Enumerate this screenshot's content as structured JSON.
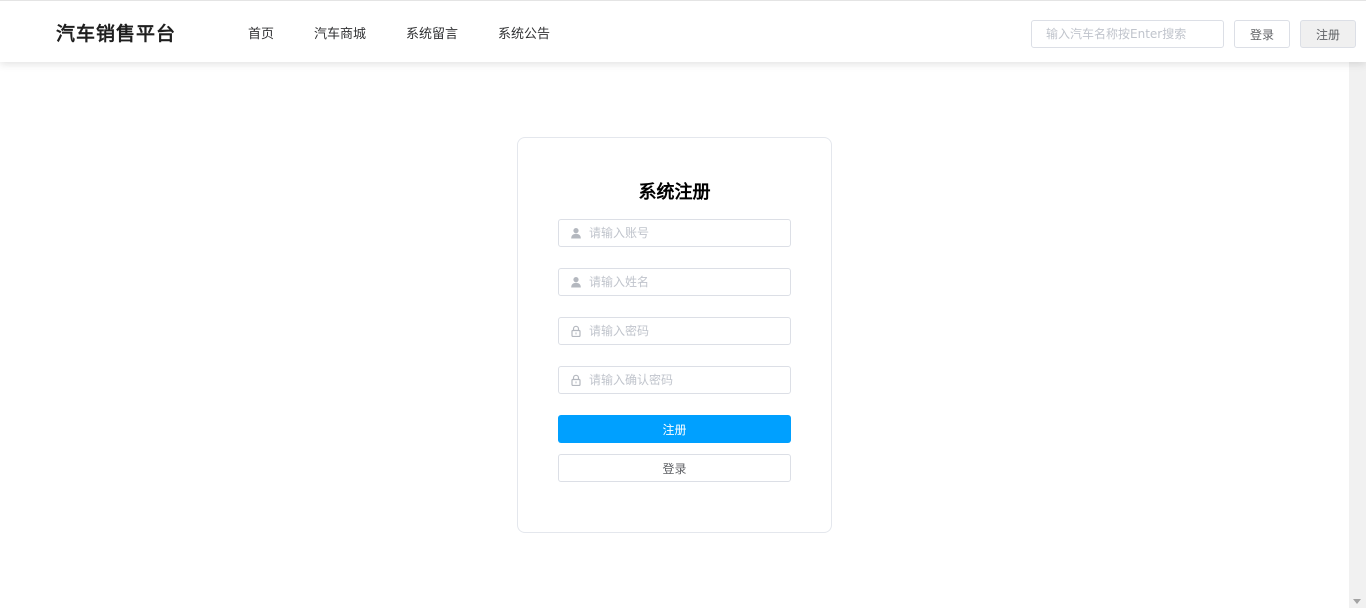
{
  "header": {
    "brand": "汽车销售平台",
    "nav": [
      "首页",
      "汽车商城",
      "系统留言",
      "系统公告"
    ],
    "search_placeholder": "输入汽车名称按Enter搜索",
    "login_label": "登录",
    "register_label": "注册"
  },
  "form": {
    "title": "系统注册",
    "fields": [
      {
        "placeholder": "请输入账号",
        "icon": "user-icon"
      },
      {
        "placeholder": "请输入姓名",
        "icon": "user-icon"
      },
      {
        "placeholder": "请输入密码",
        "icon": "lock-icon"
      },
      {
        "placeholder": "请输入确认密码",
        "icon": "lock-icon"
      }
    ],
    "submit_label": "注册",
    "login_label": "登录"
  },
  "colors": {
    "primary": "#00a0ff",
    "border": "#dcdfe6",
    "placeholder": "#c0c4cc"
  }
}
